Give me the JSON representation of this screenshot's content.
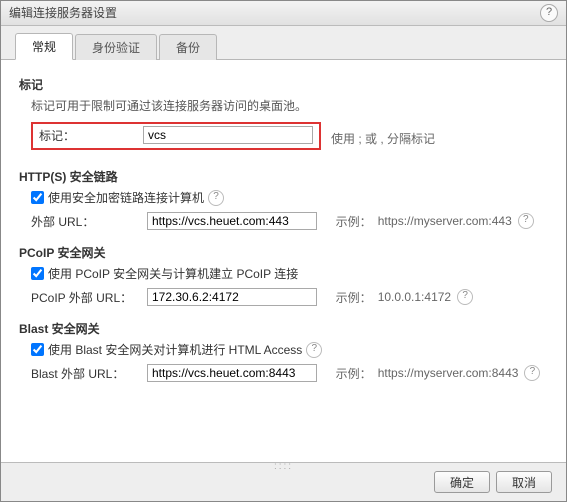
{
  "window": {
    "title": "编辑连接服务器设置"
  },
  "tabs": {
    "general": "常规",
    "auth": "身份验证",
    "backup": "备份"
  },
  "tag_section": {
    "title": "标记",
    "desc": "标记可用于限制可通过该连接服务器访问的桌面池。",
    "label": "标记：",
    "value": "vcs",
    "hint": "使用 ; 或 , 分隔标记"
  },
  "http_section": {
    "title": "HTTP(S) 安全链路",
    "cb": "使用安全加密链路连接计算机",
    "url_lbl": "外部 URL：",
    "url_val": "https://vcs.heuet.com:443",
    "example_lbl": "示例：",
    "example_val": "https://myserver.com:443"
  },
  "pcoip_section": {
    "title": "PCoIP 安全网关",
    "cb": "使用 PCoIP 安全网关与计算机建立 PCoIP 连接",
    "url_lbl": "PCoIP 外部 URL：",
    "url_val": "172.30.6.2:4172",
    "example_lbl": "示例：",
    "example_val": "10.0.0.1:4172"
  },
  "blast_section": {
    "title": "Blast 安全网关",
    "cb": "使用 Blast 安全网关对计算机进行 HTML Access",
    "url_lbl": "Blast 外部 URL：",
    "url_val": "https://vcs.heuet.com:8443",
    "example_lbl": "示例：",
    "example_val": "https://myserver.com:8443"
  },
  "footer": {
    "ok": "确定",
    "cancel": "取消"
  }
}
